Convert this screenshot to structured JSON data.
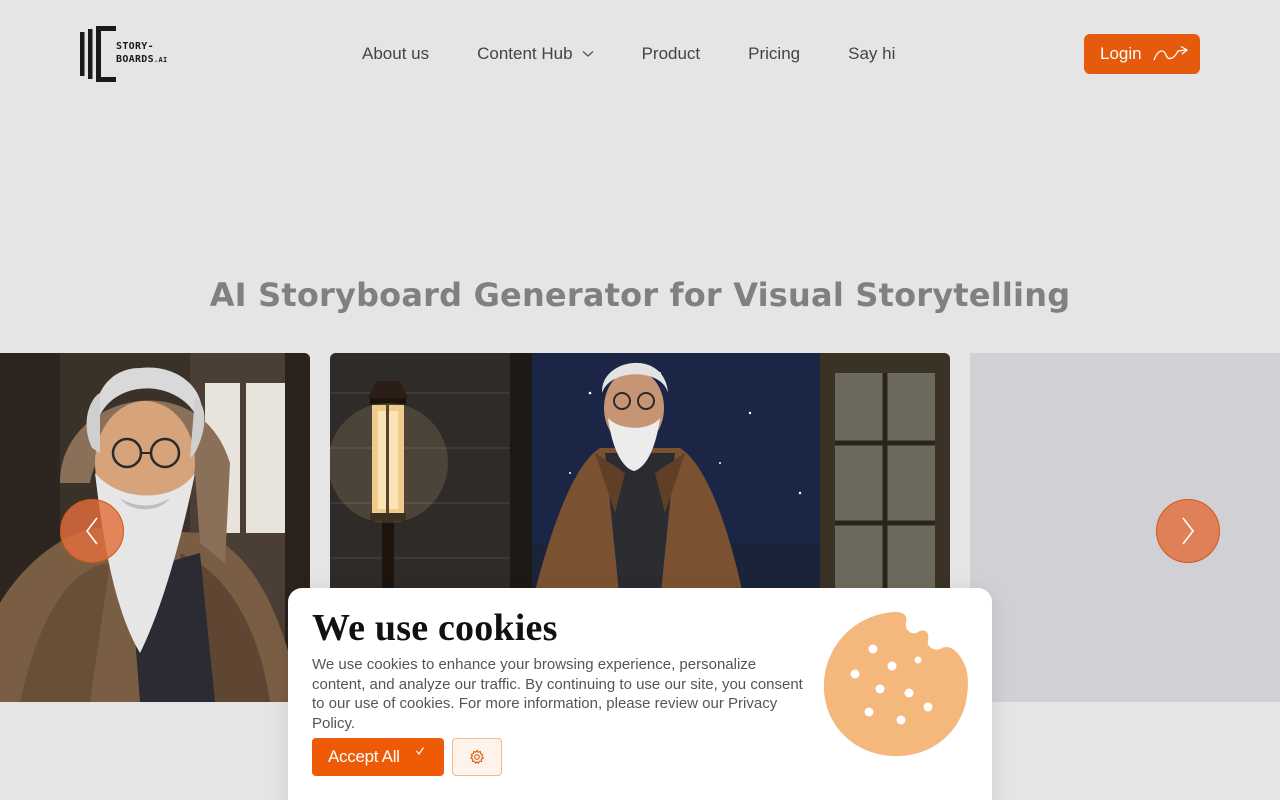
{
  "brand": {
    "logo_line1": "STORY-",
    "logo_line2": "BOARDS",
    "logo_suffix": ".AI",
    "accent_color": "#e55a0c"
  },
  "nav": {
    "items": [
      {
        "label": "About us"
      },
      {
        "label": "Content Hub",
        "icon": "chevron-down-icon"
      },
      {
        "label": "Product"
      },
      {
        "label": "Pricing"
      },
      {
        "label": "Say hi"
      }
    ]
  },
  "header": {
    "login_label": "Login",
    "login_icon": "curved-arrow-icon"
  },
  "hero": {
    "title": "AI Storyboard Generator for Visual Storytelling"
  },
  "carousel": {
    "prev_icon": "chevron-left-icon",
    "next_icon": "chevron-right-icon"
  },
  "cookie_banner": {
    "title": "We use cookies",
    "text": "We use cookies to enhance your browsing experience, personalize content, and analyze our traffic. By continuing to use our site, you consent to our use of cookies. For more information, please review our Privacy Policy.",
    "accept_label": "Accept All",
    "accept_icon": "check-icon",
    "settings_icon": "gear-icon",
    "illustration_icon": "cookie-icon"
  }
}
